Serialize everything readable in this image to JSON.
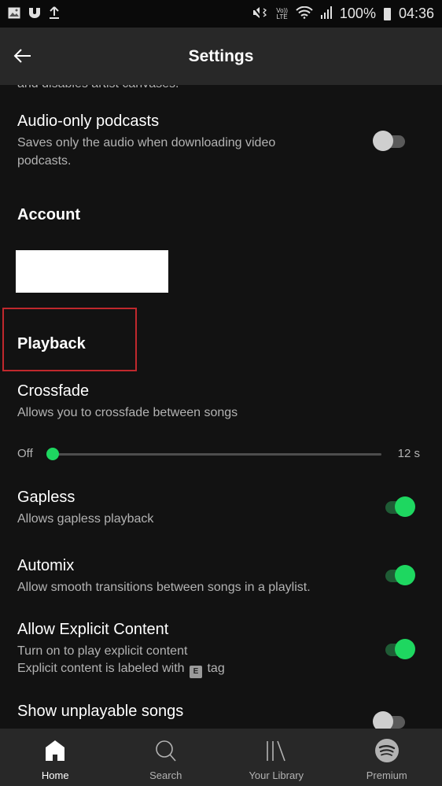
{
  "status_bar": {
    "left_icons": [
      "gallery-icon",
      "shield-icon",
      "upload-icon"
    ],
    "right_icons": [
      "mute-vibrate-icon",
      "volte-icon",
      "wifi-icon",
      "signal-icon",
      "battery-icon"
    ],
    "volte_label_top": "Vo))",
    "volte_label_bottom": "LTE",
    "battery": "100%",
    "time": "04:36"
  },
  "header": {
    "title": "Settings",
    "back_icon": "arrow-left-icon"
  },
  "content": {
    "cut_off_text": "and disables artist canvases.",
    "audio_only": {
      "title": "Audio-only podcasts",
      "description": "Saves only the audio when downloading video podcasts.",
      "enabled": false
    },
    "account_section": "Account",
    "playback_section": "Playback",
    "crossfade": {
      "title": "Crossfade",
      "description": "Allows you to crossfade between songs",
      "min_label": "Off",
      "max_label": "12 s",
      "value_seconds": 0,
      "max_seconds": 12
    },
    "gapless": {
      "title": "Gapless",
      "description": "Allows gapless playback",
      "enabled": true
    },
    "automix": {
      "title": "Automix",
      "description": "Allow smooth transitions between songs in a playlist.",
      "enabled": true
    },
    "explicit": {
      "title": "Allow Explicit Content",
      "description_line1": "Turn on to play explicit content",
      "description_line2_before": "Explicit content is labeled with",
      "tag_letter": "E",
      "description_line2_after": "tag",
      "enabled": true
    },
    "unplayable": {
      "title": "Show unplayable songs",
      "enabled": false
    }
  },
  "bottom_nav": {
    "items": [
      {
        "label": "Home",
        "icon": "home-icon",
        "active": true
      },
      {
        "label": "Search",
        "icon": "search-icon",
        "active": false
      },
      {
        "label": "Your Library",
        "icon": "library-icon",
        "active": false
      },
      {
        "label": "Premium",
        "icon": "spotify-logo-icon",
        "active": false
      }
    ]
  },
  "colors": {
    "accent": "#1ed760",
    "highlight_box": "#c0282d",
    "background": "#121212",
    "bar_background": "#282828"
  }
}
